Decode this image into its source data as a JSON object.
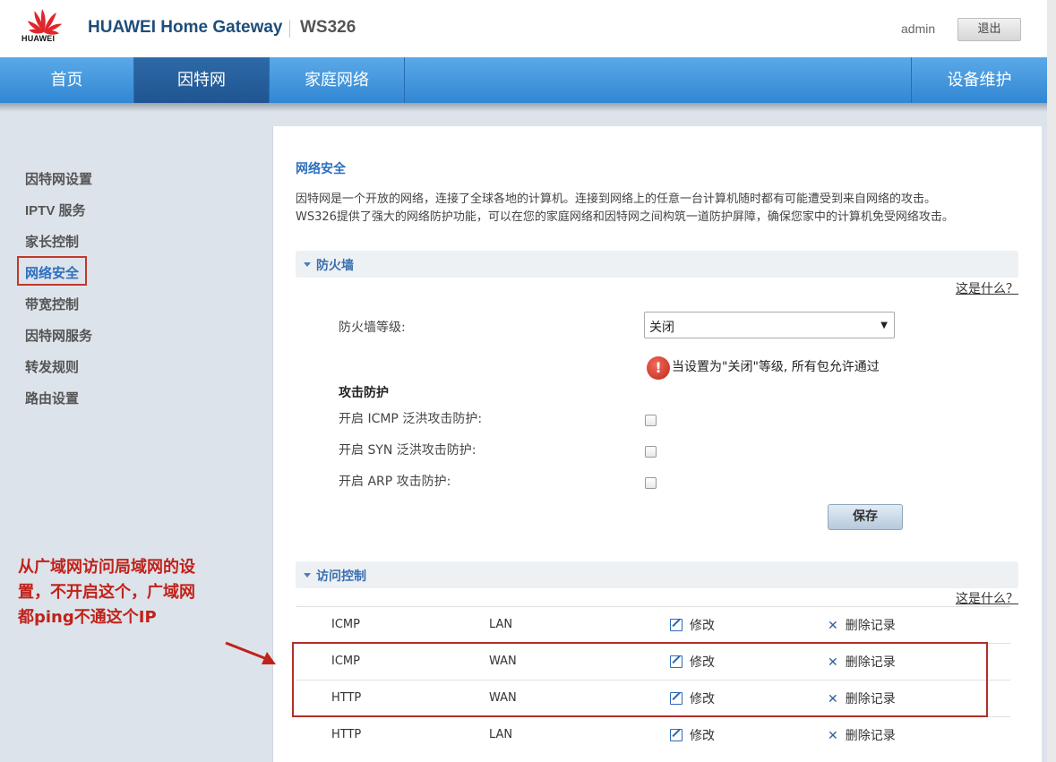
{
  "header": {
    "logo_text": "HUAWEI",
    "brand": "HUAWEI Home Gateway",
    "model": "WS326",
    "user": "admin",
    "logout": "退出"
  },
  "nav": {
    "items": [
      "首页",
      "因特网",
      "家庭网络",
      "设备维护"
    ]
  },
  "sidebar": {
    "items": [
      "因特网设置",
      "IPTV 服务",
      "家长控制",
      "网络安全",
      "带宽控制",
      "因特网服务",
      "转发规则",
      "路由设置"
    ],
    "active": "网络安全"
  },
  "main": {
    "title": "网络安全",
    "intro_1": "因特网是一个开放的网络，连接了全球各地的计算机。连接到网络上的任意一台计算机随时都有可能遭受到来自网络的攻击。",
    "intro_2": "WS326提供了强大的网络防护功能，可以在您的家庭网络和因特网之间构筑一道防护屏障，确保您家中的计算机免受网络攻击。",
    "firewall": {
      "header": "防火墙",
      "help": "这是什么？",
      "level_label": "防火墙等级:",
      "level_value": "关闭",
      "warning": "当设置为\"关闭\"等级, 所有包允许通过",
      "attack_title": "攻击防护",
      "icmp_label": "开启 ICMP 泛洪攻击防护:",
      "syn_label": "开启 SYN 泛洪攻击防护:",
      "arp_label": "开启 ARP 攻击防护:",
      "save": "保存"
    },
    "access": {
      "header": "访问控制",
      "help": "这是什么？",
      "edit_label": "修改",
      "delete_label": "删除记录",
      "rows": [
        {
          "protocol": "ICMP",
          "side": "LAN"
        },
        {
          "protocol": "ICMP",
          "side": "WAN"
        },
        {
          "protocol": "HTTP",
          "side": "WAN"
        },
        {
          "protocol": "HTTP",
          "side": "LAN"
        }
      ]
    }
  },
  "annotation": {
    "text": "从广域网访问局域网的设置，不开启这个，广域网都ping不通这个IP"
  }
}
